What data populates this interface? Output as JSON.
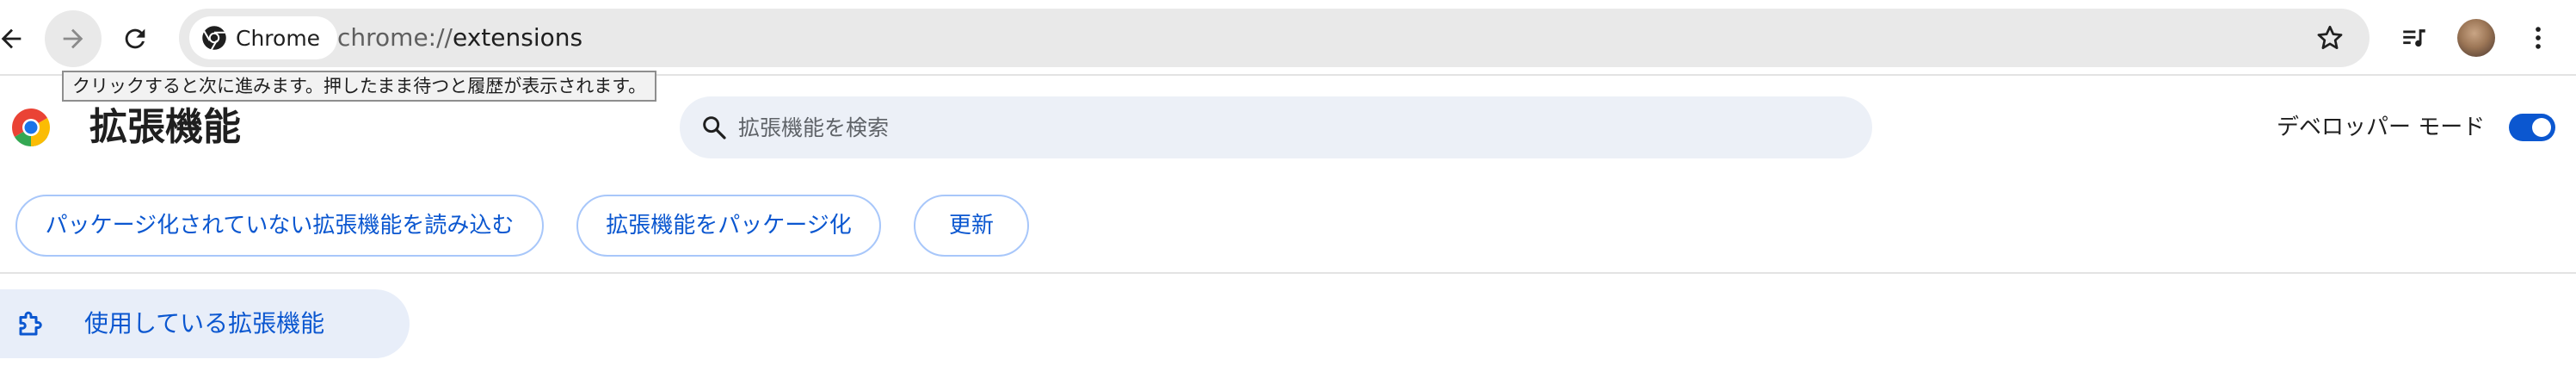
{
  "browser": {
    "chip_label": "Chrome",
    "url_scheme": "chrome://",
    "url_path": "extensions",
    "tooltip": "クリックすると次に進みます。押したまま待つと履歴が表示されます。",
    "icons": [
      "back-arrow-icon",
      "forward-arrow-icon",
      "reload-icon",
      "chrome-logo-icon",
      "star-icon",
      "media-control-icon",
      "avatar",
      "more-vert-icon"
    ]
  },
  "header": {
    "title": "拡張機能",
    "search_placeholder": "拡張機能を検索",
    "search_value": "",
    "developer_mode_label": "デベロッパー モード",
    "developer_mode_on": true
  },
  "actions": {
    "load_unpacked": "パッケージ化されていない拡張機能を読み込む",
    "pack_extension": "拡張機能をパッケージ化",
    "update": "更新"
  },
  "sidebar": {
    "items": [
      {
        "label": "使用している拡張機能",
        "icon": "puzzle-piece-icon",
        "selected": true
      }
    ]
  },
  "colors": {
    "accent": "#0b57d0",
    "button_border": "#a8c7fa",
    "search_bg": "#ecf0f7",
    "omnibox_bg": "#e9e9e9",
    "sidebar_selected_bg": "#e8eef9"
  }
}
